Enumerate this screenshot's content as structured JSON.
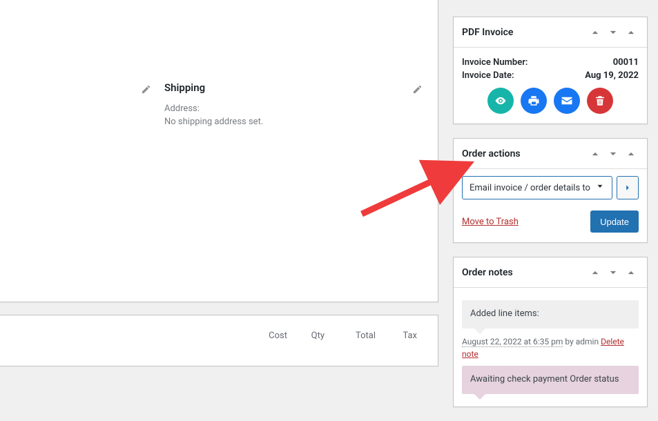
{
  "main": {
    "shipping_heading": "Shipping",
    "address_label": "Address:",
    "address_none": "No shipping address set."
  },
  "items_table": {
    "columns": {
      "cost": "Cost",
      "qty": "Qty",
      "total": "Total",
      "tax": "Tax"
    }
  },
  "sidebar": {
    "pdf_invoice": {
      "title": "PDF Invoice",
      "number_label": "Invoice Number:",
      "number_value": "00011",
      "date_label": "Invoice Date:",
      "date_value": "Aug 19, 2022",
      "action_colors": {
        "view": "#17b5a9",
        "print": "#1877f2",
        "email": "#1877f2",
        "delete": "#d63638"
      }
    },
    "order_actions": {
      "title": "Order actions",
      "select_value": "Email invoice / order details to",
      "trash": "Move to Trash",
      "update": "Update"
    },
    "order_notes": {
      "title": "Order notes",
      "notes": [
        {
          "body": "Added line items:",
          "timestamp": "August 22, 2022 at 6:35 pm",
          "by": " by admin ",
          "delete": "Delete note"
        },
        {
          "body": "Awaiting check payment Order status"
        }
      ]
    }
  }
}
